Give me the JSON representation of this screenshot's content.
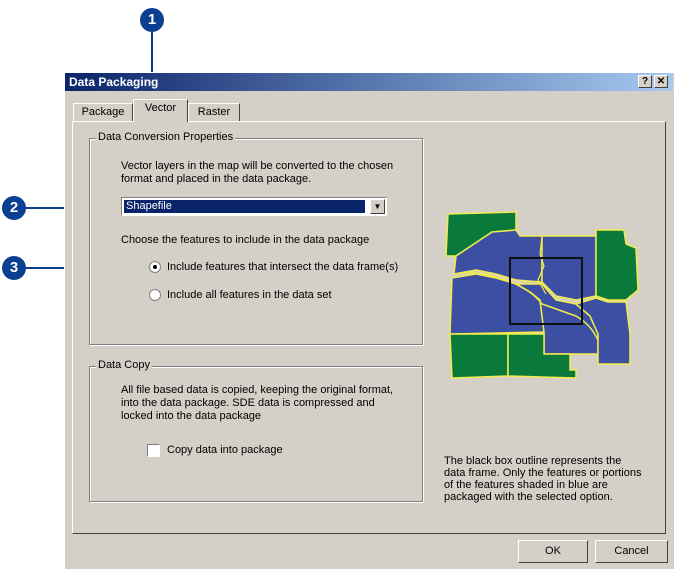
{
  "callouts": [
    "1",
    "2",
    "3"
  ],
  "window": {
    "title": "Data Packaging",
    "help_label": "?",
    "close_label": "✕"
  },
  "tabs": [
    {
      "label": "Package",
      "active": false
    },
    {
      "label": "Vector",
      "active": true
    },
    {
      "label": "Raster",
      "active": false
    }
  ],
  "conversion": {
    "group_title": "Data Conversion Properties",
    "description_line1": "Vector layers in the map will be converted to the chosen",
    "description_line2": "format and placed in the data package.",
    "format_selected": "Shapefile",
    "features_prompt": "Choose the features to include in the data package",
    "option_intersect": "Include features that intersect the data frame(s)",
    "option_all": "Include all features in the data set",
    "selected_option": "option_intersect"
  },
  "copy": {
    "group_title": "Data Copy",
    "description_line1": "All file based data is copied, keeping the original format,",
    "description_line2": "into the data package.  SDE data is compressed and",
    "description_line3": "locked into the data package",
    "checkbox_label": "Copy data into package",
    "checked": false
  },
  "map": {
    "caption_line1": "The black box outline represents the",
    "caption_line2": "data frame.  Only the features or portions",
    "caption_line3": "of the features shaded in blue are",
    "caption_line4": "packaged with the selected option.",
    "colors": {
      "selected": "#3c4fa3",
      "unselected": "#0a7a3c",
      "border": "#f2ec4a"
    }
  },
  "buttons": {
    "ok": "OK",
    "cancel": "Cancel"
  }
}
